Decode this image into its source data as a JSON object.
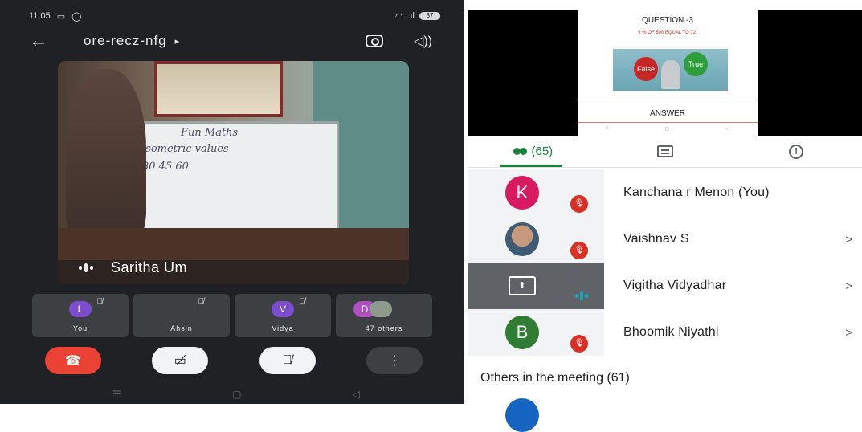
{
  "status_bar": {
    "time": "11:05",
    "battery": "37"
  },
  "call": {
    "meeting_code": "ore-recz-nfg",
    "caret": "▸",
    "speaker_name": "Saritha Um",
    "board_text": [
      "Fun Maths",
      "isometric values",
      "30  45  60"
    ],
    "tiles": [
      {
        "initial": "L",
        "label": "You",
        "color": "#7c4dce"
      },
      {
        "initial": "",
        "label": "Ahsin",
        "color": ""
      },
      {
        "initial": "V",
        "label": "Vidya",
        "color": "#7c4dce"
      },
      {
        "initial": "D",
        "label": "47 others",
        "color": "#b04fc2"
      }
    ]
  },
  "slide": {
    "title": "QUESTION -3",
    "question": "9 % OF 800 EQUAL TO  72.",
    "false_label": "False",
    "true_label": "True",
    "answer_label": "ANSWER"
  },
  "tabs": {
    "people_count": "(65)"
  },
  "participants": [
    {
      "name": "Kanchana r Menon (You)",
      "initial": "K",
      "avatar_color": "#d81b60",
      "state": "muted"
    },
    {
      "name": "Vaishnav S",
      "initial": "",
      "avatar_color": "#8d6e63",
      "state": "muted"
    },
    {
      "name": "Vigitha Vidyadhar",
      "initial": "",
      "avatar_color": "",
      "state": "presenting"
    },
    {
      "name": "Bhoomik Niyathi",
      "initial": "B",
      "avatar_color": "#2e7d32",
      "state": "muted"
    }
  ],
  "others_heading": "Others in the meeting (61)",
  "chevron": ">"
}
